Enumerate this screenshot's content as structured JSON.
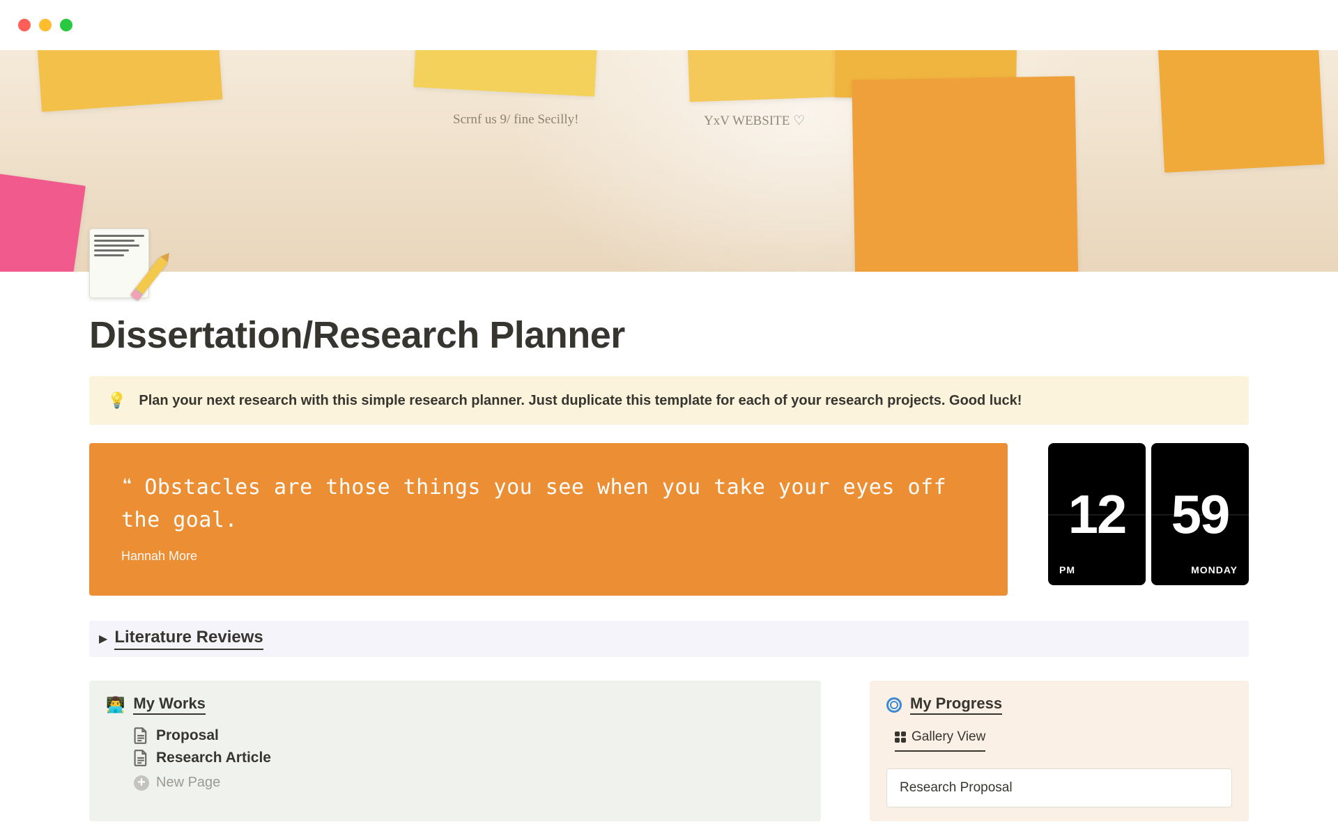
{
  "page": {
    "title": "Dissertation/Research Planner"
  },
  "callout": {
    "icon": "💡",
    "text": "Plan your next research with this simple research planner. Just duplicate this template for each of your research projects. Good luck!"
  },
  "quote": {
    "text": "Obstacles are those things you see when you take your eyes off the goal.",
    "author": "Hannah More"
  },
  "clock": {
    "hour": "12",
    "minute": "59",
    "meridiem": "PM",
    "day": "MONDAY"
  },
  "toggle": {
    "title": "Literature Reviews"
  },
  "works": {
    "icon": "👨‍💻",
    "title": "My Works",
    "items": [
      "Proposal",
      "Research Article"
    ],
    "new_page_label": "New Page"
  },
  "progress": {
    "title": "My Progress",
    "view_label": "Gallery View",
    "items": [
      "Research Proposal"
    ]
  },
  "cover_scribbles": {
    "s1": "Scrnf us 9/\nfine Secilly!",
    "s2": "YxV WEBSITE\n♡"
  }
}
